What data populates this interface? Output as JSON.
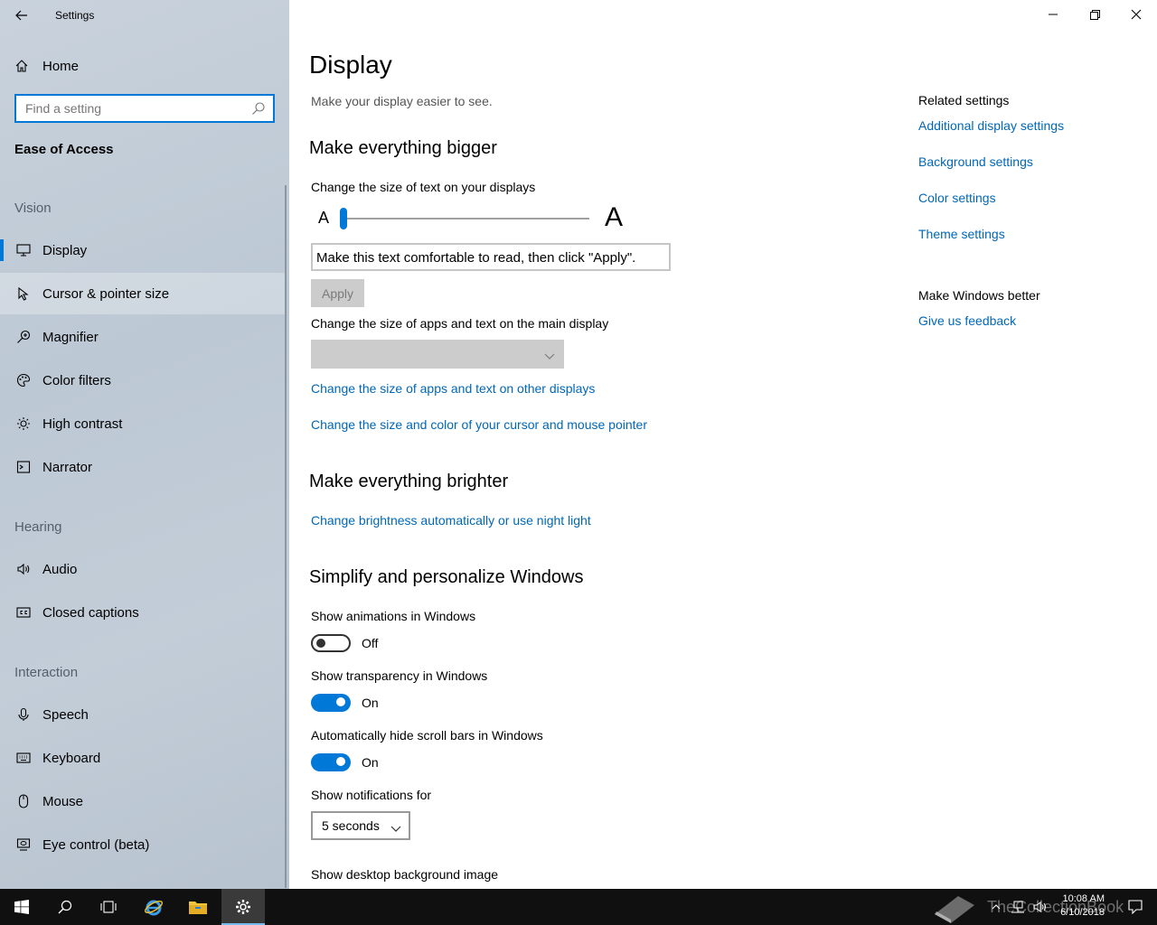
{
  "window": {
    "title": "Settings"
  },
  "sidebar": {
    "home_label": "Home",
    "search_placeholder": "Find a setting",
    "section_title": "Ease of Access",
    "groups": {
      "vision": "Vision",
      "hearing": "Hearing",
      "interaction": "Interaction"
    },
    "items": [
      {
        "label": "Display",
        "icon": "monitor-icon",
        "selected": true
      },
      {
        "label": "Cursor & pointer size",
        "icon": "cursor-icon"
      },
      {
        "label": "Magnifier",
        "icon": "magnifier-icon"
      },
      {
        "label": "Color filters",
        "icon": "palette-icon"
      },
      {
        "label": "High contrast",
        "icon": "sun-icon"
      },
      {
        "label": "Narrator",
        "icon": "narrator-icon"
      },
      {
        "label": "Audio",
        "icon": "speaker-icon"
      },
      {
        "label": "Closed captions",
        "icon": "captions-icon"
      },
      {
        "label": "Speech",
        "icon": "microphone-icon"
      },
      {
        "label": "Keyboard",
        "icon": "keyboard-icon"
      },
      {
        "label": "Mouse",
        "icon": "mouse-icon"
      },
      {
        "label": "Eye control (beta)",
        "icon": "eye-icon"
      }
    ]
  },
  "main": {
    "title": "Display",
    "subtitle": "Make your display easier to see.",
    "bigger": {
      "heading": "Make everything bigger",
      "text_size_label": "Change the size of text on your displays",
      "slider_small": "A",
      "slider_big": "A",
      "slider_value": 0,
      "preview_text": "Make this text comfortable to read, then click \"Apply\".",
      "apply_label": "Apply",
      "apps_size_label": "Change the size of apps and text on the main display",
      "link_other_displays": "Change the size of apps and text on other displays",
      "link_cursor": "Change the size and color of your cursor and mouse pointer"
    },
    "brighter": {
      "heading": "Make everything brighter",
      "link_brightness": "Change brightness automatically or use night light"
    },
    "simplify": {
      "heading": "Simplify and personalize Windows",
      "animations_label": "Show animations in Windows",
      "animations_state": "Off",
      "transparency_label": "Show transparency in Windows",
      "transparency_state": "On",
      "scrollbars_label": "Automatically hide scroll bars in Windows",
      "scrollbars_state": "On",
      "notifications_label": "Show notifications for",
      "notifications_value": "5 seconds",
      "desktop_bg_label": "Show desktop background image"
    }
  },
  "related": {
    "heading": "Related settings",
    "links": [
      "Additional display settings",
      "Background settings",
      "Color settings",
      "Theme settings"
    ],
    "better_heading": "Make Windows better",
    "feedback_link": "Give us feedback"
  },
  "taskbar": {
    "time": "10:08 AM",
    "date": "6/10/2018",
    "watermark": "TheCollectionBook"
  },
  "colors": {
    "accent": "#0078d7",
    "link": "#0067b8"
  }
}
